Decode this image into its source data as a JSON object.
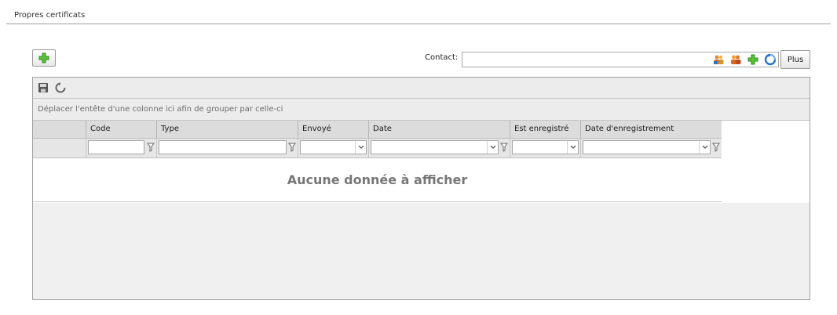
{
  "page": {
    "title": "Propres certificats"
  },
  "toolbar_top": {
    "contact_label": "Contact:",
    "contact_value": "",
    "more_label": "Plus",
    "add_icon": "green-plus-icon",
    "contact_icons": [
      "contacts-search-icon",
      "contacts-group-icon",
      "add-contact-icon",
      "refresh-icon"
    ]
  },
  "grid": {
    "toolbar_icons": [
      "save-icon",
      "refresh-icon"
    ],
    "group_panel_text": "Déplacer l'entête d'une colonne ici afin de grouper par celle-ci",
    "columns": [
      "Code",
      "Type",
      "Envoyé",
      "Date",
      "Est enregistré",
      "Date d'enregistrement"
    ],
    "empty_text": "Aucune donnée à afficher"
  },
  "colors": {
    "accent_green": "#3fae2a",
    "refresh_blue": "#2a73c9",
    "header_bg": "#dcdcdc",
    "panel_bg": "#ececec"
  }
}
